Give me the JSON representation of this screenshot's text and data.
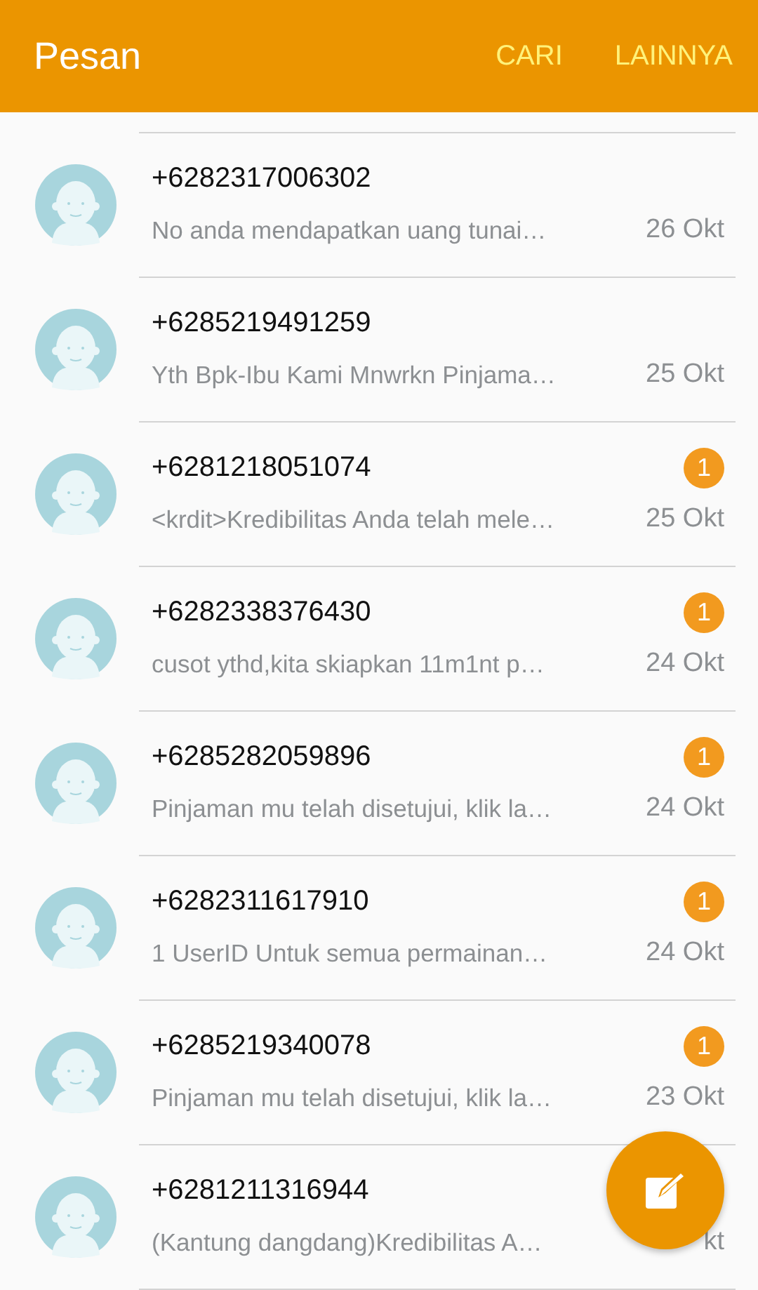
{
  "app_bar": {
    "title": "Pesan",
    "actions": [
      "CARI",
      "LAINNYA"
    ]
  },
  "conversations": [
    {
      "sender": "+6282317006302",
      "snippet": "No anda mendapatkan uang tunai…",
      "date": "26 Okt"
    },
    {
      "sender": "+6285219491259",
      "snippet": "Yth Bpk-Ibu Kami Mnwrkn Pinjama…",
      "date": "25 Okt"
    },
    {
      "sender": "+6281218051074",
      "snippet": "<krdit>Kredibilitas Anda telah mele…",
      "date": "25 Okt",
      "unread": "1"
    },
    {
      "sender": "+6282338376430",
      "snippet": "cusot ythd,kita skiapkan 11m1nt p…",
      "date": "24 Okt",
      "unread": "1"
    },
    {
      "sender": "+6285282059896",
      "snippet": "Pinjaman mu telah disetujui, klik la…",
      "date": "24 Okt",
      "unread": "1"
    },
    {
      "sender": "+6282311617910",
      "snippet": "1 UserID Untuk semua permainan…",
      "date": "24 Okt",
      "unread": "1"
    },
    {
      "sender": "+6285219340078",
      "snippet": "Pinjaman mu telah disetujui, klik la…",
      "date": "23 Okt",
      "unread": "1"
    },
    {
      "sender": "+6281211316944",
      "snippet": "(Kantung dangdang)Kredibilitas A…",
      "date": "kt"
    }
  ]
}
